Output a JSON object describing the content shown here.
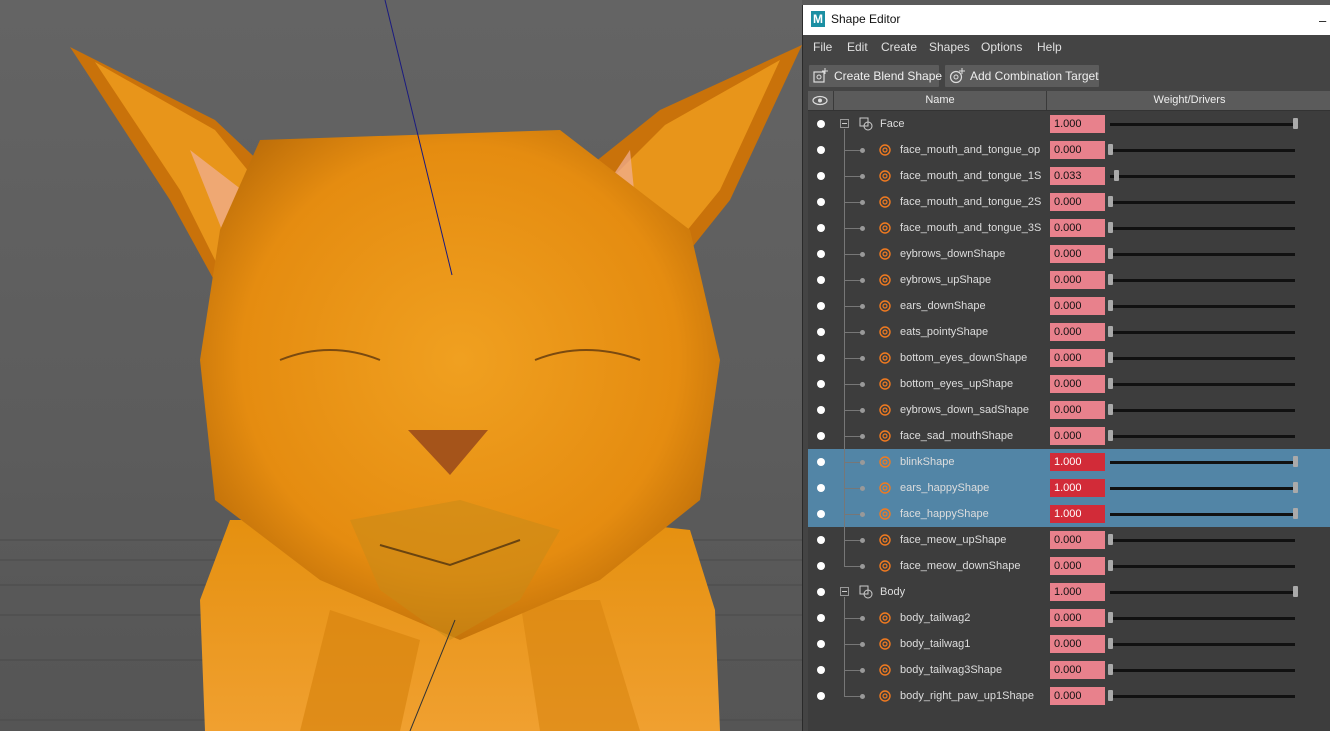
{
  "window": {
    "title": "Shape Editor",
    "logo_letter": "M",
    "minimize_glyph": "–"
  },
  "menu": [
    "File",
    "Edit",
    "Create",
    "Shapes",
    "Options",
    "Help"
  ],
  "toolbar": {
    "create_blend_shape": "Create Blend Shape",
    "add_combination_target": "Add Combination Target"
  },
  "columns": {
    "name": "Name",
    "weight": "Weight/Drivers"
  },
  "colors": {
    "selected_row": "#5285a6",
    "weight_field": "#e8818c",
    "weight_field_selected": "#d22b38",
    "cat_orange": "#e8930e"
  },
  "rows": [
    {
      "type": "group",
      "name": "Face",
      "weight": "1.000",
      "value": 1.0,
      "selected": false
    },
    {
      "type": "target",
      "name": "face_mouth_and_tongue_op",
      "weight": "0.000",
      "value": 0.0,
      "selected": false
    },
    {
      "type": "target",
      "name": "face_mouth_and_tongue_1S",
      "weight": "0.033",
      "value": 0.033,
      "selected": false
    },
    {
      "type": "target",
      "name": "face_mouth_and_tongue_2S",
      "weight": "0.000",
      "value": 0.0,
      "selected": false
    },
    {
      "type": "target",
      "name": "face_mouth_and_tongue_3S",
      "weight": "0.000",
      "value": 0.0,
      "selected": false
    },
    {
      "type": "target",
      "name": "eybrows_downShape",
      "weight": "0.000",
      "value": 0.0,
      "selected": false
    },
    {
      "type": "target",
      "name": "eybrows_upShape",
      "weight": "0.000",
      "value": 0.0,
      "selected": false
    },
    {
      "type": "target",
      "name": "ears_downShape",
      "weight": "0.000",
      "value": 0.0,
      "selected": false
    },
    {
      "type": "target",
      "name": "eats_pointyShape",
      "weight": "0.000",
      "value": 0.0,
      "selected": false
    },
    {
      "type": "target",
      "name": "bottom_eyes_downShape",
      "weight": "0.000",
      "value": 0.0,
      "selected": false
    },
    {
      "type": "target",
      "name": "bottom_eyes_upShape",
      "weight": "0.000",
      "value": 0.0,
      "selected": false
    },
    {
      "type": "target",
      "name": "eybrows_down_sadShape",
      "weight": "0.000",
      "value": 0.0,
      "selected": false
    },
    {
      "type": "target",
      "name": "face_sad_mouthShape",
      "weight": "0.000",
      "value": 0.0,
      "selected": false
    },
    {
      "type": "target",
      "name": "blinkShape",
      "weight": "1.000",
      "value": 1.0,
      "selected": true
    },
    {
      "type": "target",
      "name": "ears_happyShape",
      "weight": "1.000",
      "value": 1.0,
      "selected": true
    },
    {
      "type": "target",
      "name": "face_happyShape",
      "weight": "1.000",
      "value": 1.0,
      "selected": true
    },
    {
      "type": "target",
      "name": "face_meow_upShape",
      "weight": "0.000",
      "value": 0.0,
      "selected": false
    },
    {
      "type": "target",
      "name": "face_meow_downShape",
      "weight": "0.000",
      "value": 0.0,
      "selected": false,
      "last": true
    },
    {
      "type": "group",
      "name": "Body",
      "weight": "1.000",
      "value": 1.0,
      "selected": false
    },
    {
      "type": "target",
      "name": "body_tailwag2",
      "weight": "0.000",
      "value": 0.0,
      "selected": false
    },
    {
      "type": "target",
      "name": "body_tailwag1",
      "weight": "0.000",
      "value": 0.0,
      "selected": false
    },
    {
      "type": "target",
      "name": "body_tailwag3Shape",
      "weight": "0.000",
      "value": 0.0,
      "selected": false
    },
    {
      "type": "target",
      "name": "body_right_paw_up1Shape",
      "weight": "0.000",
      "value": 0.0,
      "selected": false,
      "last": true
    }
  ]
}
